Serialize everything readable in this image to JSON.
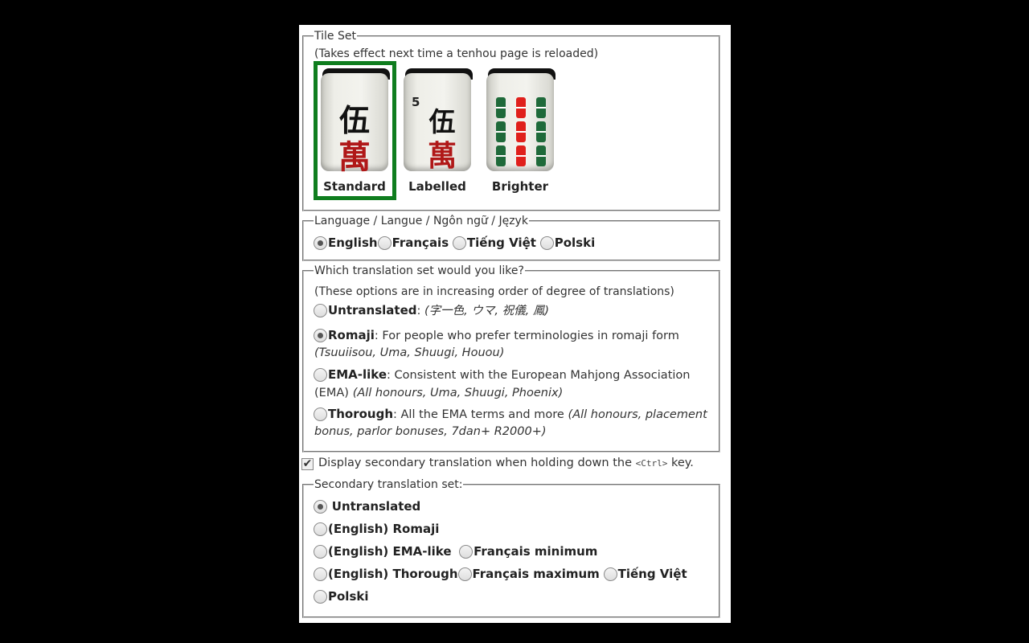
{
  "tileset": {
    "legend": "Tile Set",
    "note": "(Takes effect next time a tenhou page is reloaded)",
    "tiles": [
      {
        "label": "Standard",
        "selected": true,
        "top": "伍",
        "bottom": "萬"
      },
      {
        "label": "Labelled",
        "selected": false,
        "corner": "5",
        "top": "伍",
        "bottom": "萬"
      },
      {
        "label": "Brighter",
        "selected": false
      }
    ]
  },
  "language": {
    "legend": "Language / Langue / Ngôn ngữ / Język",
    "options": [
      "English",
      "Français",
      "Tiếng Việt",
      "Polski"
    ],
    "selected": "English"
  },
  "translation": {
    "legend": "Which translation set would you like?",
    "note": "(These options are in increasing order of degree of translations)",
    "options": [
      {
        "name": "Untranslated",
        "sep": ": ",
        "examples": "(字一色, ウマ, 祝儀, 鳳)"
      },
      {
        "name": "Romaji",
        "sep": ": ",
        "desc": "For people who prefer terminologies in romaji form",
        "examples": "(Tsuuiisou, Uma, Shuugi, Houou)"
      },
      {
        "name": "EMA-like",
        "sep": ": ",
        "desc": "Consistent with the European Mahjong Association",
        "desc2": "(EMA)",
        "examples": "(All honours, Uma, Shuugi, Phoenix)"
      },
      {
        "name": "Thorough",
        "sep": ": ",
        "desc": "All the EMA terms and more",
        "examples1": "(All honours, placement",
        "examples2": "bonus, parlor bonuses, 7dan+ R2000+)"
      }
    ],
    "selected": "Romaji"
  },
  "secondary_toggle": {
    "checked": true,
    "text_before": "Display secondary translation when holding down the",
    "key": "<Ctrl>",
    "text_after": "key."
  },
  "secondary": {
    "legend": "Secondary translation set:",
    "options": [
      "Untranslated",
      "(English) Romaji",
      "(English) EMA-like",
      "Français minimum",
      "(English) Thorough",
      "Français maximum",
      "Tiếng Việt",
      "Polski"
    ],
    "selected": "Untranslated"
  }
}
